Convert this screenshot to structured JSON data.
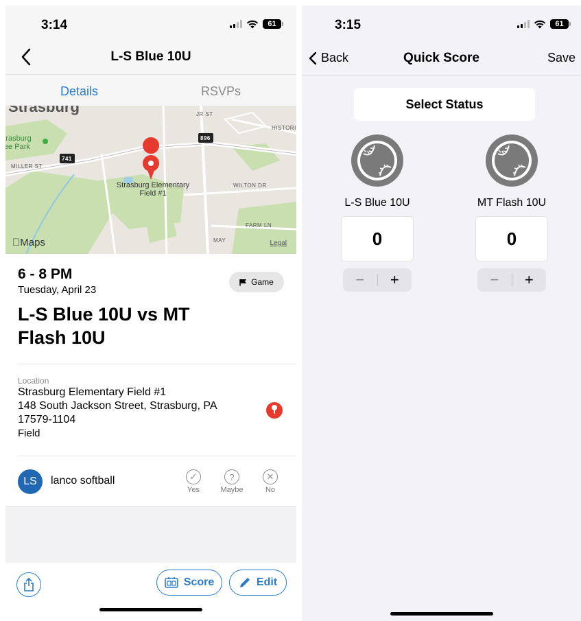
{
  "left": {
    "status_time": "3:14",
    "battery": "61",
    "nav_title": "L-S Blue 10U",
    "tabs": [
      "Details",
      "RSVPs"
    ],
    "map": {
      "places": [
        "Strasburg",
        "Strasburg Cee Park",
        "Strasburg Elementary Field #1"
      ],
      "streets": [
        "MILLER ST",
        "JR ST",
        "HISTORIC",
        "WILTON DR",
        "FARM LN",
        "MAY"
      ],
      "route_shields": [
        "741",
        "896"
      ],
      "maps_label": "Maps",
      "legal": "Legal"
    },
    "event": {
      "time": "6 - 8 PM",
      "date": "Tuesday, April 23",
      "title": "L-S Blue 10U vs MT Flash 10U",
      "badge": "Game"
    },
    "location": {
      "label": "Location",
      "name": "Strasburg Elementary Field #1",
      "address": "148 South Jackson Street, Strasburg, PA 17579-1104",
      "type": "Field"
    },
    "rsvp": {
      "initials": "LS",
      "name": "lanco softball",
      "options": [
        "Yes",
        "Maybe",
        "No"
      ]
    },
    "actions": {
      "score": "Score",
      "edit": "Edit"
    }
  },
  "right": {
    "status_time": "3:15",
    "battery": "61",
    "back": "Back",
    "title": "Quick Score",
    "save": "Save",
    "select_status": "Select Status",
    "teams": [
      {
        "name": "L-S Blue 10U",
        "score": "0"
      },
      {
        "name": "MT Flash 10U",
        "score": "0"
      }
    ],
    "stepper": {
      "minus": "−",
      "plus": "+"
    }
  },
  "colors": {
    "accent": "#2a7bc9",
    "pin": "#e63a2e",
    "avatar": "#2068b2",
    "ball_grey": "#7a7a7a"
  }
}
